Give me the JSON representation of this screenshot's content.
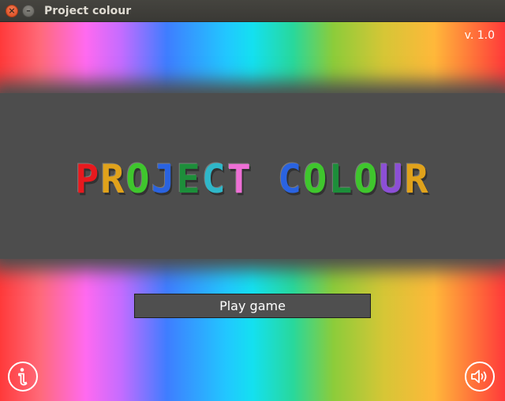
{
  "window": {
    "title": "Project colour",
    "close_glyph": "×",
    "minimize_glyph": "–"
  },
  "game": {
    "version": "v. 1.0",
    "logo": {
      "letters": [
        {
          "char": "P",
          "color": "#e8191e"
        },
        {
          "char": "R",
          "color": "#e0a21b"
        },
        {
          "char": "O",
          "color": "#3fc62d"
        },
        {
          "char": "J",
          "color": "#2a63e0"
        },
        {
          "char": "E",
          "color": "#1d8e3a"
        },
        {
          "char": "C",
          "color": "#2fb7c9"
        },
        {
          "char": "T",
          "color": "#ee6fd6"
        },
        {
          "char": " ",
          "color": "#ffffff"
        },
        {
          "char": "C",
          "color": "#2a63e0"
        },
        {
          "char": "O",
          "color": "#3fc62d"
        },
        {
          "char": "L",
          "color": "#1d8e3a"
        },
        {
          "char": "O",
          "color": "#3fc62d"
        },
        {
          "char": "U",
          "color": "#8c4fd6"
        },
        {
          "char": "R",
          "color": "#e0a21b"
        }
      ]
    },
    "play_button_label": "Play game",
    "info_icon": "info-icon",
    "sound_icon": "sound-icon"
  }
}
